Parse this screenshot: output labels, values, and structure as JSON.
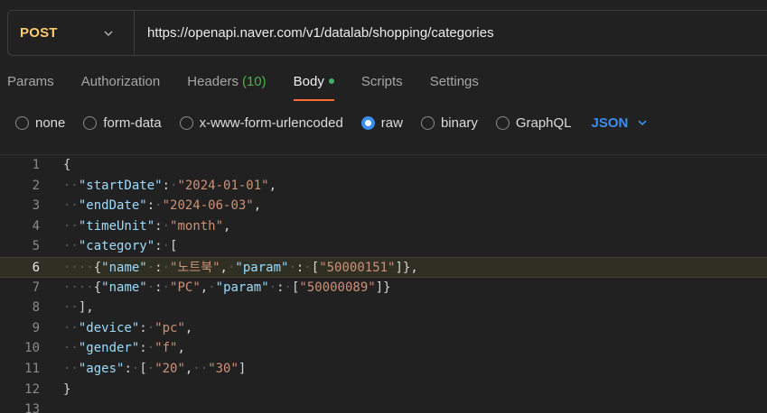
{
  "request": {
    "method": "POST",
    "url": "https://openapi.naver.com/v1/datalab/shopping/categories"
  },
  "tabs": [
    {
      "label": "Params"
    },
    {
      "label": "Authorization"
    },
    {
      "label": "Headers",
      "count": "(10)"
    },
    {
      "label": "Body",
      "active": true
    },
    {
      "label": "Scripts"
    },
    {
      "label": "Settings"
    }
  ],
  "body_types": [
    {
      "label": "none"
    },
    {
      "label": "form-data"
    },
    {
      "label": "x-www-form-urlencoded"
    },
    {
      "label": "raw",
      "selected": true
    },
    {
      "label": "binary"
    },
    {
      "label": "GraphQL"
    }
  ],
  "language": "JSON",
  "editor": {
    "highlighted_line": 6,
    "lines": [
      {
        "n": "1",
        "tokens": [
          [
            "p",
            "{"
          ]
        ]
      },
      {
        "n": "2",
        "tokens": [
          [
            "ws",
            "··"
          ],
          [
            "k",
            "\"startDate\""
          ],
          [
            "p",
            ":"
          ],
          [
            "ws",
            "·"
          ],
          [
            "s",
            "\"2024-01-01\""
          ],
          [
            "p",
            ","
          ]
        ]
      },
      {
        "n": "3",
        "tokens": [
          [
            "ws",
            "··"
          ],
          [
            "k",
            "\"endDate\""
          ],
          [
            "p",
            ":"
          ],
          [
            "ws",
            "·"
          ],
          [
            "s",
            "\"2024-06-03\""
          ],
          [
            "p",
            ","
          ]
        ]
      },
      {
        "n": "4",
        "tokens": [
          [
            "ws",
            "··"
          ],
          [
            "k",
            "\"timeUnit\""
          ],
          [
            "p",
            ":"
          ],
          [
            "ws",
            "·"
          ],
          [
            "s",
            "\"month\""
          ],
          [
            "p",
            ","
          ]
        ]
      },
      {
        "n": "5",
        "tokens": [
          [
            "ws",
            "··"
          ],
          [
            "k",
            "\"category\""
          ],
          [
            "p",
            ":"
          ],
          [
            "ws",
            "·"
          ],
          [
            "p",
            "["
          ]
        ]
      },
      {
        "n": "6",
        "tokens": [
          [
            "ws",
            "····"
          ],
          [
            "p",
            "{"
          ],
          [
            "k",
            "\"name\""
          ],
          [
            "ws",
            "·"
          ],
          [
            "p",
            ":"
          ],
          [
            "ws",
            "·"
          ],
          [
            "s",
            "\"노트북\""
          ],
          [
            "p",
            ","
          ],
          [
            "ws",
            "·"
          ],
          [
            "k",
            "\"param\""
          ],
          [
            "ws",
            "·"
          ],
          [
            "p",
            ":"
          ],
          [
            "ws",
            "·"
          ],
          [
            "p",
            "["
          ],
          [
            "s",
            "\"50000151\""
          ],
          [
            "p",
            "]},"
          ]
        ]
      },
      {
        "n": "7",
        "tokens": [
          [
            "ws",
            "····"
          ],
          [
            "p",
            "{"
          ],
          [
            "k",
            "\"name\""
          ],
          [
            "ws",
            "·"
          ],
          [
            "p",
            ":"
          ],
          [
            "ws",
            "·"
          ],
          [
            "s",
            "\"PC\""
          ],
          [
            "p",
            ","
          ],
          [
            "ws",
            "·"
          ],
          [
            "k",
            "\"param\""
          ],
          [
            "ws",
            "·"
          ],
          [
            "p",
            ":"
          ],
          [
            "ws",
            "·"
          ],
          [
            "p",
            "["
          ],
          [
            "s",
            "\"50000089\""
          ],
          [
            "p",
            "]}"
          ]
        ]
      },
      {
        "n": "8",
        "tokens": [
          [
            "ws",
            "··"
          ],
          [
            "p",
            "],"
          ]
        ]
      },
      {
        "n": "9",
        "tokens": [
          [
            "ws",
            "··"
          ],
          [
            "k",
            "\"device\""
          ],
          [
            "p",
            ":"
          ],
          [
            "ws",
            "·"
          ],
          [
            "s",
            "\"pc\""
          ],
          [
            "p",
            ","
          ]
        ]
      },
      {
        "n": "10",
        "tokens": [
          [
            "ws",
            "··"
          ],
          [
            "k",
            "\"gender\""
          ],
          [
            "p",
            ":"
          ],
          [
            "ws",
            "·"
          ],
          [
            "s",
            "\"f\""
          ],
          [
            "p",
            ","
          ]
        ]
      },
      {
        "n": "11",
        "tokens": [
          [
            "ws",
            "··"
          ],
          [
            "k",
            "\"ages\""
          ],
          [
            "p",
            ":"
          ],
          [
            "ws",
            "·"
          ],
          [
            "p",
            "["
          ],
          [
            "ws",
            "·"
          ],
          [
            "s",
            "\"20\""
          ],
          [
            "p",
            ","
          ],
          [
            "ws",
            "··"
          ],
          [
            "s",
            "\"30\""
          ],
          [
            "p",
            "]"
          ]
        ]
      },
      {
        "n": "12",
        "tokens": [
          [
            "p",
            "}"
          ]
        ]
      },
      {
        "n": "13",
        "tokens": []
      }
    ]
  }
}
